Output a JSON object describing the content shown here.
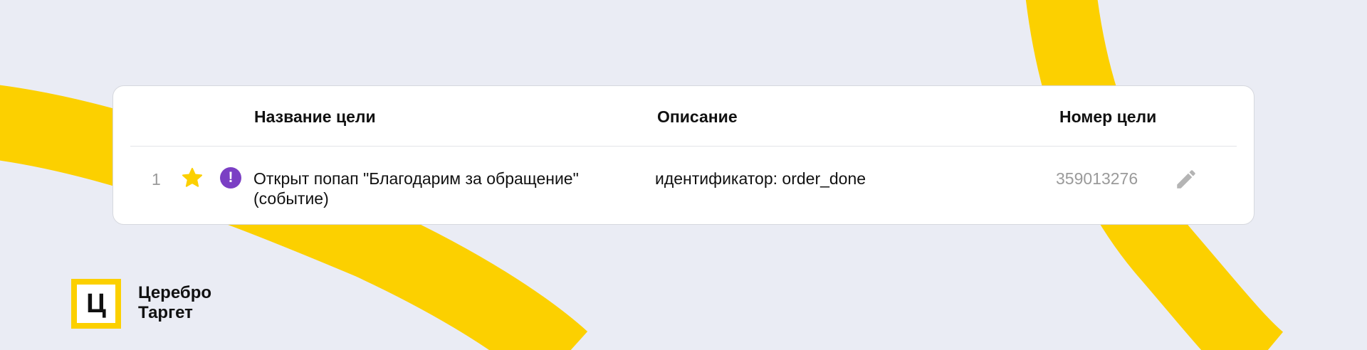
{
  "colors": {
    "background": "#eaecf4",
    "accent_yellow": "#fcd000",
    "event_icon": "#7b3fc4",
    "star": "#fcd000",
    "muted_text": "#9a9a9a"
  },
  "table": {
    "headers": {
      "name": "Название цели",
      "description": "Описание",
      "number": "Номер цели"
    },
    "rows": [
      {
        "index": "1",
        "starred": true,
        "type_icon": "exclamation-icon",
        "name": "Открыт попап \"Благодарим за обращение\" (событие)",
        "description": "идентификатор: order_done",
        "number": "359013276",
        "action_icon": "pencil-icon"
      }
    ]
  },
  "brand": {
    "logo_letter": "Ц",
    "line1": "Церебро",
    "line2": "Таргет"
  }
}
